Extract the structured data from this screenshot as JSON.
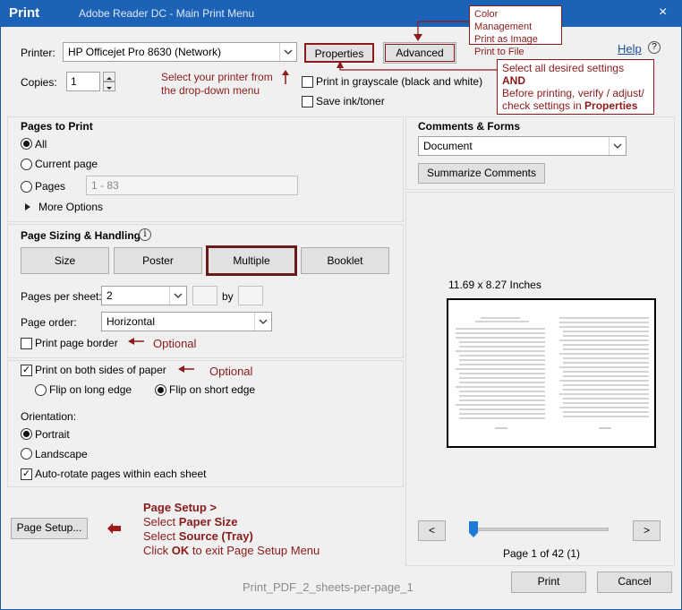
{
  "window": {
    "title": "Print",
    "subtitle": "Adobe Reader DC - Main Print Menu",
    "close": "×"
  },
  "printer": {
    "label": "Printer:",
    "value": "HP Officejet Pro 8630 (Network)",
    "properties": "Properties",
    "advanced": "Advanced",
    "help": "Help",
    "help_icon": "?"
  },
  "copies": {
    "label": "Copies:",
    "value": "1"
  },
  "options": {
    "grayscale": "Print in grayscale (black and white)",
    "save_ink": "Save ink/toner"
  },
  "annotations": {
    "printer_tip_1": "Select your printer from",
    "printer_tip_2": "the drop-down menu",
    "advanced_list": [
      "Color Management",
      "Print as Image",
      "Print to File"
    ],
    "settings_tip_1": "Select all desired settings",
    "settings_tip_2": "AND",
    "settings_tip_3": "Before printing, verify / adjust/",
    "settings_tip_4a": "check settings in ",
    "settings_tip_4b": "Properties",
    "optional_1": "Optional",
    "optional_2": "Optional",
    "setup_1": "Page Setup >",
    "setup_2a": "Select ",
    "setup_2b": "Paper Size",
    "setup_3a": "Select ",
    "setup_3b": "Source (Tray)",
    "setup_4a": "Click ",
    "setup_4b": "OK",
    "setup_4c": " to exit Page Setup Menu",
    "caption": "Print_PDF_2_sheets-per-page_1"
  },
  "pages_to_print": {
    "heading": "Pages to Print",
    "all": "All",
    "current": "Current page",
    "pages": "Pages",
    "pages_value": "1 - 83",
    "more": "More Options"
  },
  "comments": {
    "heading": "Comments & Forms",
    "value": "Document",
    "summarize": "Summarize Comments"
  },
  "sizing": {
    "heading": "Page Sizing & Handling",
    "tabs": [
      "Size",
      "Poster",
      "Multiple",
      "Booklet"
    ],
    "pps_label": "Pages per sheet:",
    "pps_value": "2",
    "by": "by",
    "order_label": "Page order:",
    "order_value": "Horizontal",
    "border": "Print page border"
  },
  "duplex": {
    "both_sides": "Print on both sides of paper",
    "long": "Flip on long edge",
    "short": "Flip on short edge"
  },
  "orientation": {
    "label": "Orientation:",
    "portrait": "Portrait",
    "landscape": "Landscape",
    "autorotate": "Auto-rotate pages within each sheet"
  },
  "preview": {
    "size": "11.69 x 8.27 Inches",
    "prev": "<",
    "next": ">",
    "page_info": "Page 1 of 42 (1)",
    "progress": 0.0
  },
  "footer": {
    "page_setup": "Page Setup...",
    "print": "Print",
    "cancel": "Cancel"
  },
  "colors": {
    "accent": "#1c63b7",
    "annotation": "#8b1a1a",
    "slider": "#1c7bd6"
  }
}
